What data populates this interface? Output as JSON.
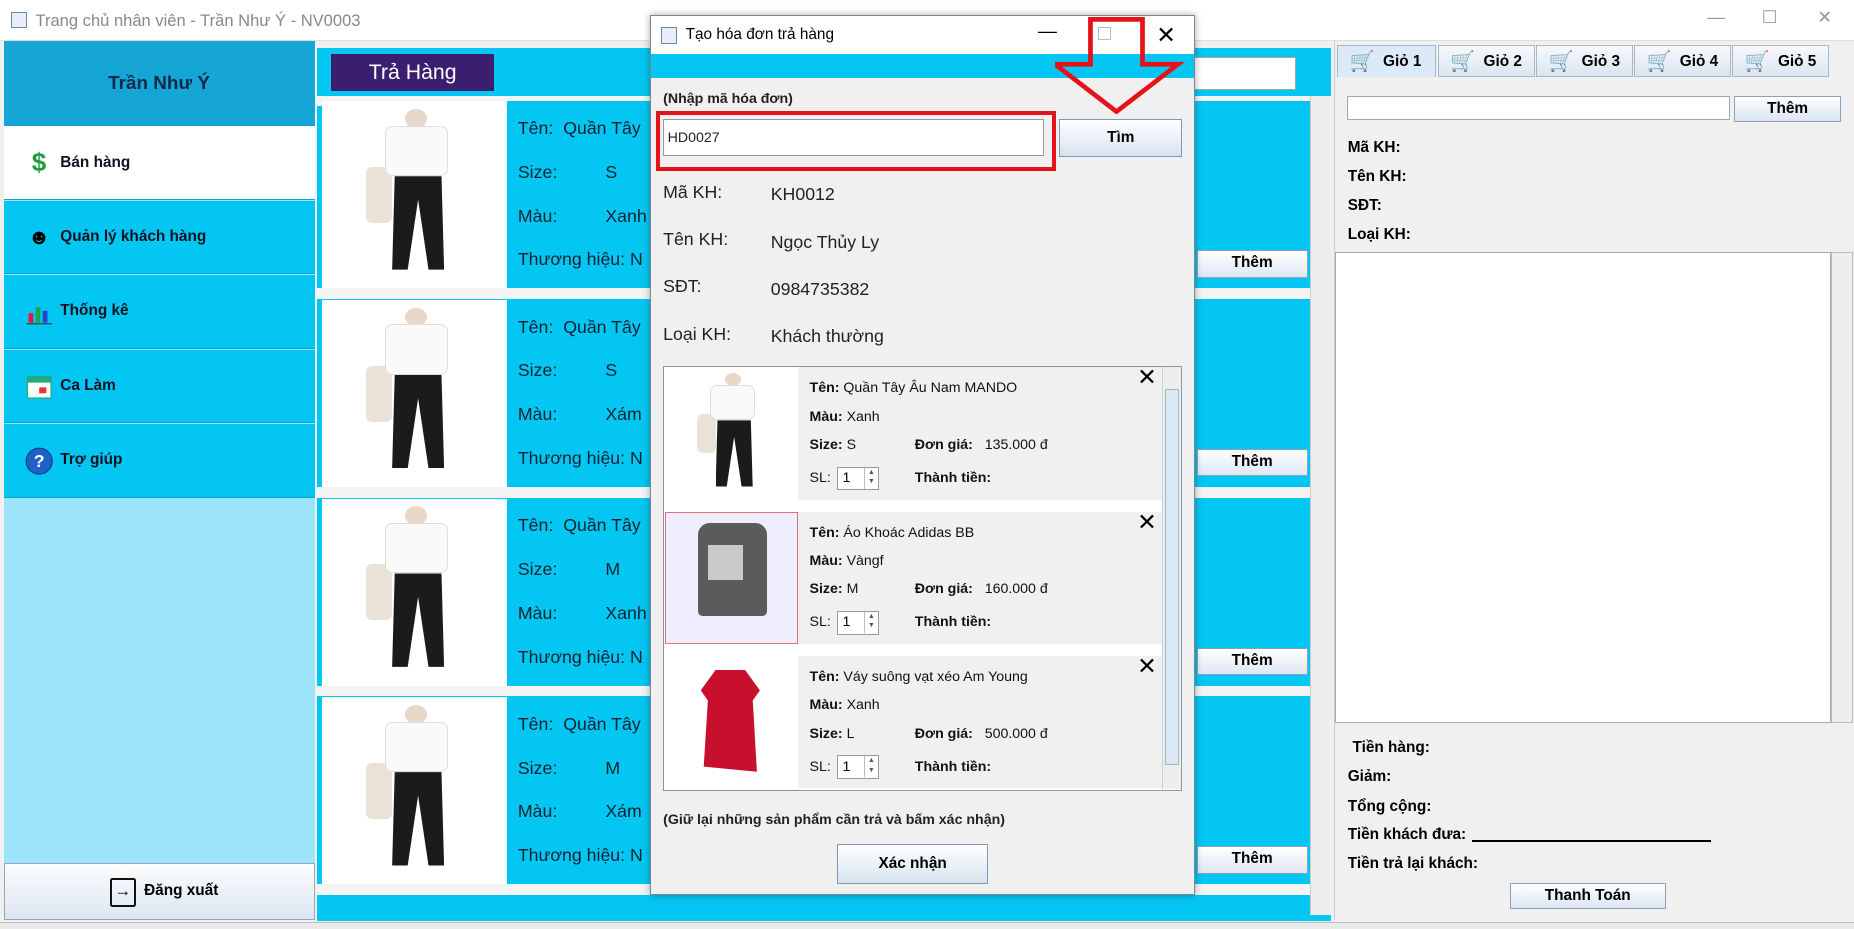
{
  "window": {
    "title": "Trang chủ nhân viên - Trần Như Ý - NV0003",
    "min": "—",
    "max": "☐",
    "close": "✕"
  },
  "sidebar": {
    "user": "Trần Như Ý",
    "items": [
      {
        "label": "Bán hàng",
        "icon": "dollar-icon"
      },
      {
        "label": "Quản lý khách hàng",
        "icon": "customers-icon"
      },
      {
        "label": "Thống kê",
        "icon": "chart-icon"
      },
      {
        "label": "Ca Làm",
        "icon": "calendar-icon"
      },
      {
        "label": "Trợ giúp",
        "icon": "help-icon"
      }
    ],
    "logout": "Đăng xuất"
  },
  "products": {
    "heading": "Trả Hàng",
    "labels": {
      "name": "Tên:",
      "size": "Size:",
      "color": "Màu:",
      "brand": "Thương hiệu:"
    },
    "add_label": "Thêm",
    "items": [
      {
        "name": "Quần Tây",
        "size": "S",
        "color": "Xanh"
      },
      {
        "name": "Quần Tây",
        "size": "S",
        "color": "Xám"
      },
      {
        "name": "Quần Tây",
        "size": "M",
        "color": "Xanh"
      },
      {
        "name": "Quần Tây",
        "size": "M",
        "color": "Xám"
      }
    ],
    "brand_partial": "N"
  },
  "right": {
    "tabs": [
      "Giỏ 1",
      "Giỏ 2",
      "Giỏ 3",
      "Giỏ 4",
      "Giỏ 5"
    ],
    "add_label": "Thêm",
    "customer_labels": [
      "Mã KH:",
      "Tên KH:",
      "SĐT:",
      "Loại KH:"
    ],
    "totals_labels": [
      "Tiền hàng:",
      "Giảm:",
      "Tổng cộng:",
      "Tiền khách đưa:",
      "Tiền trả lại khách:"
    ],
    "pay_label": "Thanh Toán"
  },
  "dialog": {
    "title": "Tạo hóa đơn trả hàng",
    "prompt": "(Nhập mã hóa đơn)",
    "invoice_code": "HD0027",
    "find_label": "Tìm",
    "customer": [
      {
        "label": "Mã KH:",
        "value": "KH0012"
      },
      {
        "label": "Tên KH:",
        "value": "Ngọc Thủy Ly"
      },
      {
        "label": "SĐT:",
        "value": "0984735382"
      },
      {
        "label": "Loại KH:",
        "value": "Khách thường"
      }
    ],
    "item_labels": {
      "name": "Tên:",
      "color": "Màu:",
      "size": "Size:",
      "unit_price": "Đơn giá:",
      "qty": "SL:",
      "total": "Thành tiền:"
    },
    "items": [
      {
        "name": "Quần Tây Âu Nam MANDO",
        "color": "Xanh",
        "size": "S",
        "unit_price": "135.000 đ",
        "qty": "1"
      },
      {
        "name": "Áo Khoác Adidas BB",
        "color": "Vàngf",
        "size": "M",
        "unit_price": "160.000 đ",
        "qty": "1"
      },
      {
        "name": "Váy suông vạt xéo Am Young",
        "color": "Xanh",
        "size": "L",
        "unit_price": "500.000 đ",
        "qty": "1"
      }
    ],
    "note": "(Giữ lại những sản phẩm cần trả và bấm xác nhận)",
    "confirm_label": "Xác nhận"
  },
  "colors": {
    "accent": "#04c6f2",
    "header": "#15a6d5",
    "annotation_red": "#e5121a",
    "heading_purple": "#3b1e6f"
  }
}
